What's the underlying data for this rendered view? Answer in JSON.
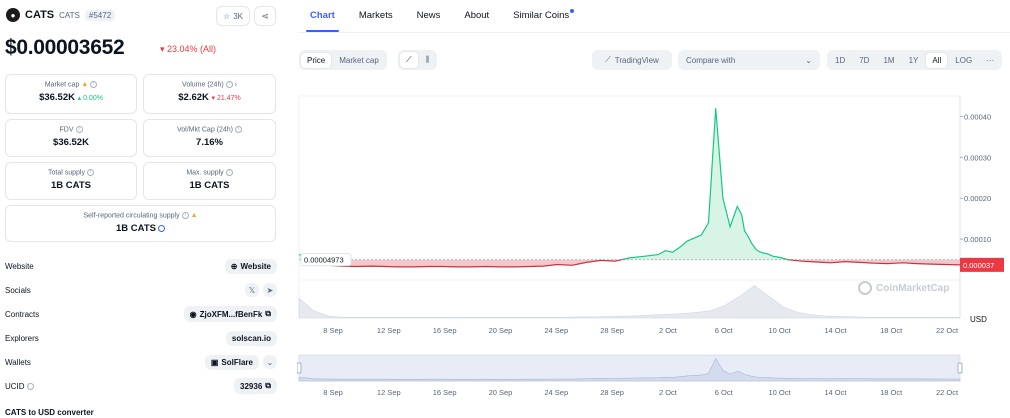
{
  "coin": {
    "name": "CATS",
    "symbol": "CATS",
    "rank": "#5472",
    "watch_count": "3K",
    "price": "$0.00003652",
    "change": "▾ 23.04% (All)"
  },
  "stats": {
    "market_cap": {
      "label": "Market cap",
      "value": "$36.52K",
      "change": "▴ 0.00%"
    },
    "volume": {
      "label": "Volume (24h)",
      "value": "$2.62K",
      "change": "▾ 21.47%"
    },
    "fdv": {
      "label": "FDV",
      "value": "$36.52K"
    },
    "vol_mkt": {
      "label": "Vol/Mkt Cap (24h)",
      "value": "7.16%"
    },
    "total_supply": {
      "label": "Total supply",
      "value": "1B CATS"
    },
    "max_supply": {
      "label": "Max. supply",
      "value": "1B CATS"
    },
    "self_reported": {
      "label": "Self-reported circulating supply",
      "value": "1B CATS"
    }
  },
  "links": {
    "website_label": "Website",
    "website_value": "Website",
    "socials_label": "Socials",
    "contracts_label": "Contracts",
    "contracts_value": "ZjoXFM...fBenFk",
    "explorers_label": "Explorers",
    "explorers_value": "solscan.io",
    "wallets_label": "Wallets",
    "wallets_value": "SolFlare",
    "ucid_label": "UCID",
    "ucid_value": "32936"
  },
  "converter_title": "CATS to USD converter",
  "tabs": [
    "Chart",
    "Markets",
    "News",
    "About",
    "Similar Coins"
  ],
  "controls": {
    "price_label": "Price",
    "mcap_label": "Market cap",
    "tradingview_label": "TradingView",
    "compare_placeholder": "Compare with",
    "ranges": [
      "1D",
      "7D",
      "1M",
      "1Y",
      "All",
      "LOG"
    ],
    "more": "···"
  },
  "chart_data": {
    "type": "line",
    "title": "",
    "x_ticks": [
      "8 Sep",
      "12 Sep",
      "16 Sep",
      "20 Sep",
      "24 Sep",
      "28 Sep",
      "2 Oct",
      "6 Oct",
      "10 Oct",
      "14 Oct",
      "18 Oct",
      "22 Oct"
    ],
    "y_ticks": [
      "0.00040",
      "0.00030",
      "0.00020",
      "0.00010"
    ],
    "ylim": [
      0,
      0.00045
    ],
    "baseline": 4.973e-05,
    "baseline_label": "0.00004973",
    "current_label": "0.000037",
    "currency": "USD",
    "series": [
      {
        "x": [
          0,
          0.6,
          1,
          2,
          3,
          4,
          5,
          6,
          7,
          8,
          9,
          10,
          11,
          12,
          13,
          14,
          15,
          16,
          17,
          18,
          19,
          20,
          21,
          22,
          23,
          24,
          25,
          25.5,
          26,
          26.5,
          27,
          28,
          28.5,
          29,
          29.5,
          30,
          30.5,
          30.8,
          31,
          31.2,
          31.5,
          31.8,
          32,
          32.3,
          32.6,
          33,
          33.5,
          34,
          35,
          36,
          37,
          38,
          39,
          40,
          41,
          42,
          43,
          44,
          45,
          46
        ],
        "values": [
          6.2e-05,
          5.8e-05,
          4.1e-05,
          3.6e-05,
          3.4e-05,
          3.3e-05,
          3.4e-05,
          3.3e-05,
          3.2e-05,
          3.2e-05,
          3.3e-05,
          3.3e-05,
          3.2e-05,
          3.2e-05,
          3.3e-05,
          3.2e-05,
          3.2e-05,
          3.3e-05,
          3.4e-05,
          3.8e-05,
          3.6e-05,
          4.3e-05,
          4.8e-05,
          4.6e-05,
          5.4e-05,
          5.8e-05,
          6.2e-05,
          7.2e-05,
          6.8e-05,
          8e-05,
          9.5e-05,
          0.00011,
          0.00014,
          0.00042,
          0.0002,
          0.00013,
          0.00018,
          0.00016,
          0.00012,
          0.00011,
          9e-05,
          7.5e-05,
          7e-05,
          6.6e-05,
          6.4e-05,
          5.8e-05,
          5.5e-05,
          5e-05,
          4.6e-05,
          4.4e-05,
          4.2e-05,
          4.5e-05,
          4.3e-05,
          4.1e-05,
          4e-05,
          4.2e-05,
          4e-05,
          3.9e-05,
          3.8e-05,
          3.7e-05
        ]
      }
    ],
    "volume": [
      0.55,
      0.2,
      0.05,
      0.02,
      0.02,
      0.02,
      0.02,
      0.02,
      0.02,
      0.02,
      0.02,
      0.02,
      0.02,
      0.02,
      0.02,
      0.02,
      0.02,
      0.02,
      0.02,
      0.03,
      0.03,
      0.04,
      0.05,
      0.06,
      0.08,
      0.1,
      0.12,
      0.15,
      0.2,
      0.35,
      0.6,
      0.9,
      0.6,
      0.3,
      0.15,
      0.08,
      0.05,
      0.04,
      0.03,
      0.02,
      0.02,
      0.02,
      0.02,
      0.02,
      0.02,
      0.02
    ]
  },
  "watermark": "CoinMarketCap"
}
